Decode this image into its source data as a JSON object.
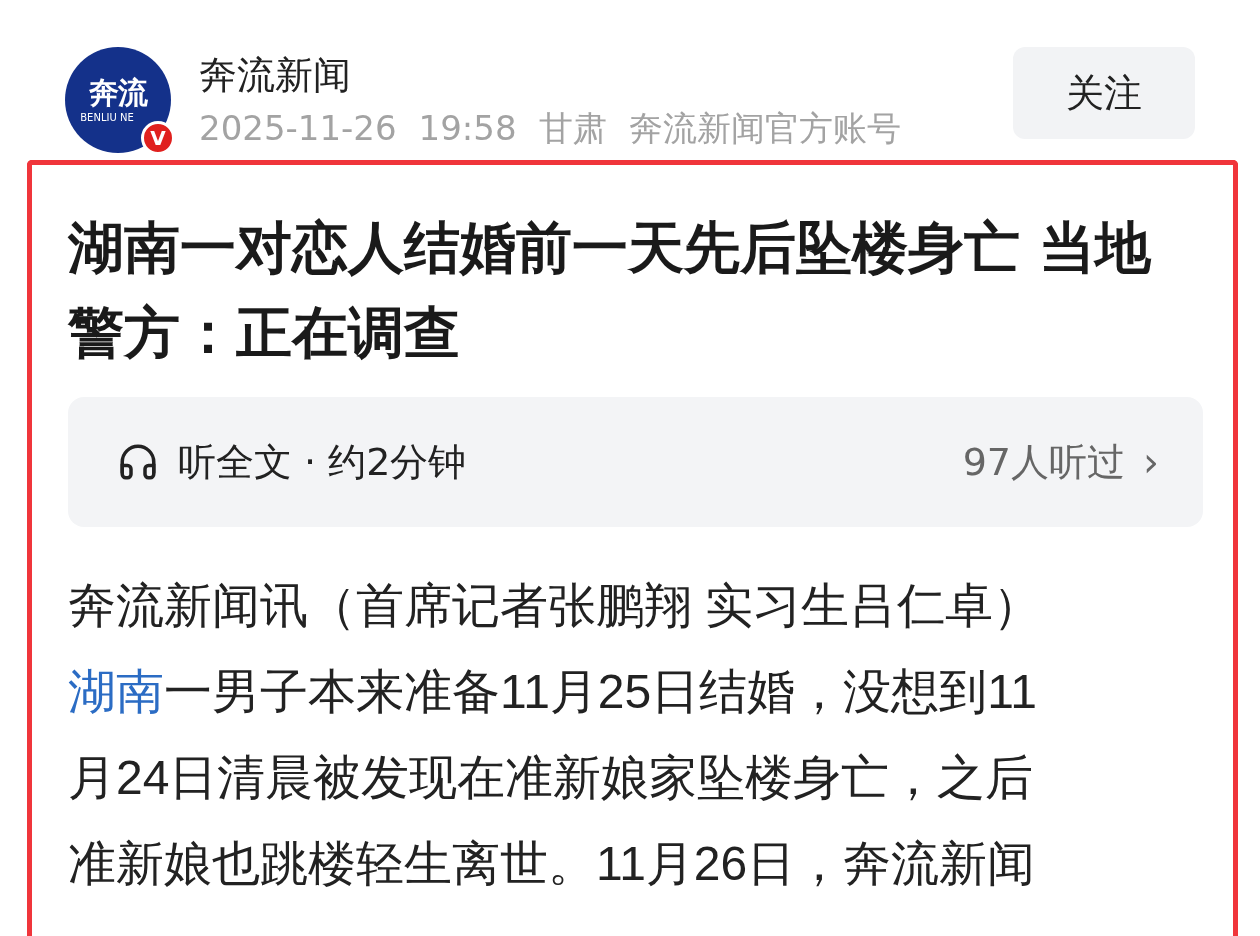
{
  "header": {
    "avatar": {
      "logo_text": "奔流",
      "logo_subtext": "BENLIU NE",
      "verified": true,
      "badge": "V"
    },
    "account_name": "奔流新闻",
    "meta": [
      "2025-11-26",
      "19:58",
      "甘肃",
      "奔流新闻官方账号"
    ],
    "follow_button": "关注"
  },
  "highlight_frame": {
    "color": "#f0353b"
  },
  "article": {
    "title": "湖南一对恋人结婚前一天先后坠楼身亡 当地警方：正在调查",
    "audio": {
      "label": "听全文 · 约2分钟",
      "listeners": "97人听过",
      "chevron": "›"
    },
    "paragraph_lines": [
      [
        {
          "kind": "text",
          "text": "奔流新闻讯（首席记者张鹏翔 实习生吕仁卓）"
        }
      ],
      [
        {
          "kind": "link",
          "text": "湖南"
        },
        {
          "kind": "text",
          "text": "一男子本来准备11月25日结婚，没想到11"
        }
      ],
      [
        {
          "kind": "text",
          "text": "月24日清晨被发现在准新娘家坠楼身亡，之后"
        }
      ],
      [
        {
          "kind": "text",
          "text": "准新娘也跳楼轻生离世。11月26日，奔流新闻"
        }
      ]
    ]
  }
}
